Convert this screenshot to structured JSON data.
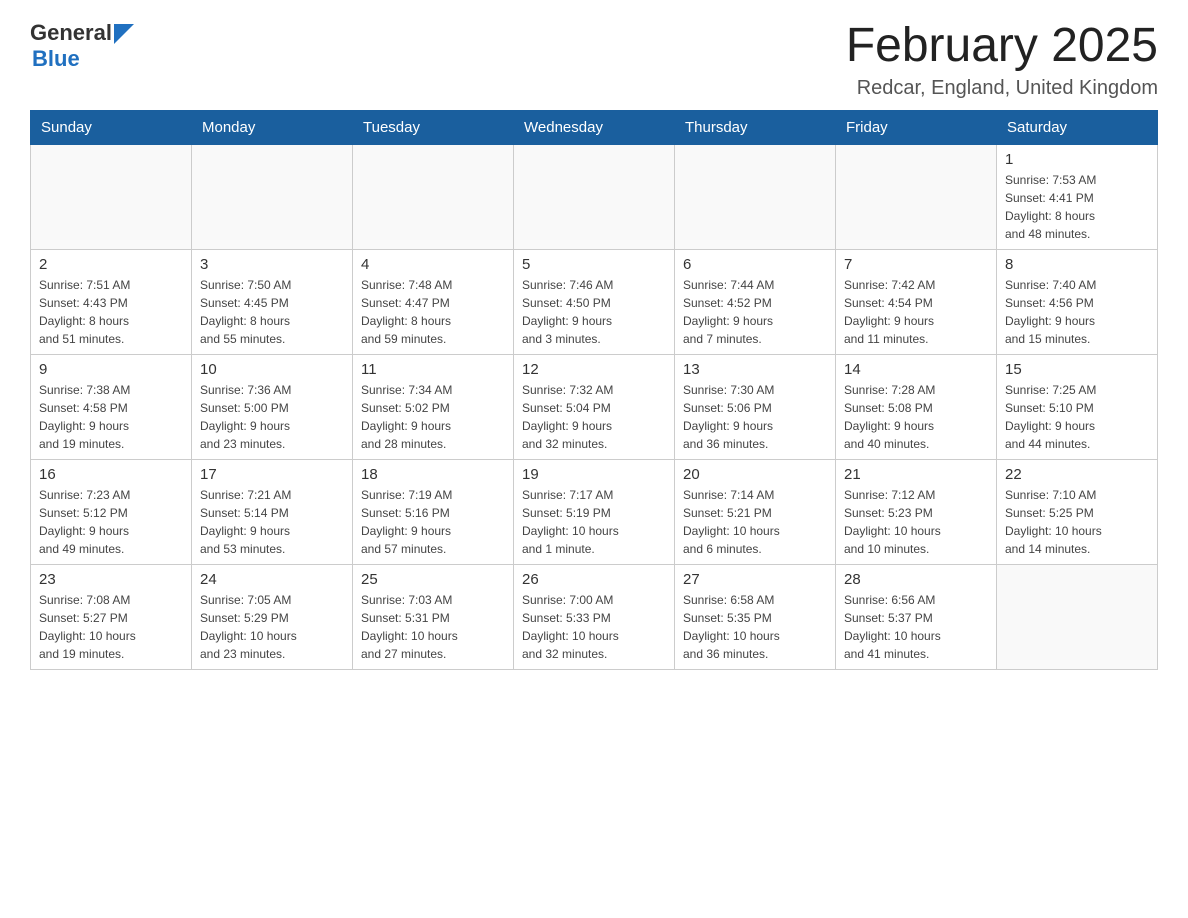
{
  "header": {
    "logo_general": "General",
    "logo_blue": "Blue",
    "title": "February 2025",
    "subtitle": "Redcar, England, United Kingdom"
  },
  "weekdays": [
    "Sunday",
    "Monday",
    "Tuesday",
    "Wednesday",
    "Thursday",
    "Friday",
    "Saturday"
  ],
  "weeks": [
    [
      {
        "day": "",
        "info": ""
      },
      {
        "day": "",
        "info": ""
      },
      {
        "day": "",
        "info": ""
      },
      {
        "day": "",
        "info": ""
      },
      {
        "day": "",
        "info": ""
      },
      {
        "day": "",
        "info": ""
      },
      {
        "day": "1",
        "info": "Sunrise: 7:53 AM\nSunset: 4:41 PM\nDaylight: 8 hours\nand 48 minutes."
      }
    ],
    [
      {
        "day": "2",
        "info": "Sunrise: 7:51 AM\nSunset: 4:43 PM\nDaylight: 8 hours\nand 51 minutes."
      },
      {
        "day": "3",
        "info": "Sunrise: 7:50 AM\nSunset: 4:45 PM\nDaylight: 8 hours\nand 55 minutes."
      },
      {
        "day": "4",
        "info": "Sunrise: 7:48 AM\nSunset: 4:47 PM\nDaylight: 8 hours\nand 59 minutes."
      },
      {
        "day": "5",
        "info": "Sunrise: 7:46 AM\nSunset: 4:50 PM\nDaylight: 9 hours\nand 3 minutes."
      },
      {
        "day": "6",
        "info": "Sunrise: 7:44 AM\nSunset: 4:52 PM\nDaylight: 9 hours\nand 7 minutes."
      },
      {
        "day": "7",
        "info": "Sunrise: 7:42 AM\nSunset: 4:54 PM\nDaylight: 9 hours\nand 11 minutes."
      },
      {
        "day": "8",
        "info": "Sunrise: 7:40 AM\nSunset: 4:56 PM\nDaylight: 9 hours\nand 15 minutes."
      }
    ],
    [
      {
        "day": "9",
        "info": "Sunrise: 7:38 AM\nSunset: 4:58 PM\nDaylight: 9 hours\nand 19 minutes."
      },
      {
        "day": "10",
        "info": "Sunrise: 7:36 AM\nSunset: 5:00 PM\nDaylight: 9 hours\nand 23 minutes."
      },
      {
        "day": "11",
        "info": "Sunrise: 7:34 AM\nSunset: 5:02 PM\nDaylight: 9 hours\nand 28 minutes."
      },
      {
        "day": "12",
        "info": "Sunrise: 7:32 AM\nSunset: 5:04 PM\nDaylight: 9 hours\nand 32 minutes."
      },
      {
        "day": "13",
        "info": "Sunrise: 7:30 AM\nSunset: 5:06 PM\nDaylight: 9 hours\nand 36 minutes."
      },
      {
        "day": "14",
        "info": "Sunrise: 7:28 AM\nSunset: 5:08 PM\nDaylight: 9 hours\nand 40 minutes."
      },
      {
        "day": "15",
        "info": "Sunrise: 7:25 AM\nSunset: 5:10 PM\nDaylight: 9 hours\nand 44 minutes."
      }
    ],
    [
      {
        "day": "16",
        "info": "Sunrise: 7:23 AM\nSunset: 5:12 PM\nDaylight: 9 hours\nand 49 minutes."
      },
      {
        "day": "17",
        "info": "Sunrise: 7:21 AM\nSunset: 5:14 PM\nDaylight: 9 hours\nand 53 minutes."
      },
      {
        "day": "18",
        "info": "Sunrise: 7:19 AM\nSunset: 5:16 PM\nDaylight: 9 hours\nand 57 minutes."
      },
      {
        "day": "19",
        "info": "Sunrise: 7:17 AM\nSunset: 5:19 PM\nDaylight: 10 hours\nand 1 minute."
      },
      {
        "day": "20",
        "info": "Sunrise: 7:14 AM\nSunset: 5:21 PM\nDaylight: 10 hours\nand 6 minutes."
      },
      {
        "day": "21",
        "info": "Sunrise: 7:12 AM\nSunset: 5:23 PM\nDaylight: 10 hours\nand 10 minutes."
      },
      {
        "day": "22",
        "info": "Sunrise: 7:10 AM\nSunset: 5:25 PM\nDaylight: 10 hours\nand 14 minutes."
      }
    ],
    [
      {
        "day": "23",
        "info": "Sunrise: 7:08 AM\nSunset: 5:27 PM\nDaylight: 10 hours\nand 19 minutes."
      },
      {
        "day": "24",
        "info": "Sunrise: 7:05 AM\nSunset: 5:29 PM\nDaylight: 10 hours\nand 23 minutes."
      },
      {
        "day": "25",
        "info": "Sunrise: 7:03 AM\nSunset: 5:31 PM\nDaylight: 10 hours\nand 27 minutes."
      },
      {
        "day": "26",
        "info": "Sunrise: 7:00 AM\nSunset: 5:33 PM\nDaylight: 10 hours\nand 32 minutes."
      },
      {
        "day": "27",
        "info": "Sunrise: 6:58 AM\nSunset: 5:35 PM\nDaylight: 10 hours\nand 36 minutes."
      },
      {
        "day": "28",
        "info": "Sunrise: 6:56 AM\nSunset: 5:37 PM\nDaylight: 10 hours\nand 41 minutes."
      },
      {
        "day": "",
        "info": ""
      }
    ]
  ]
}
